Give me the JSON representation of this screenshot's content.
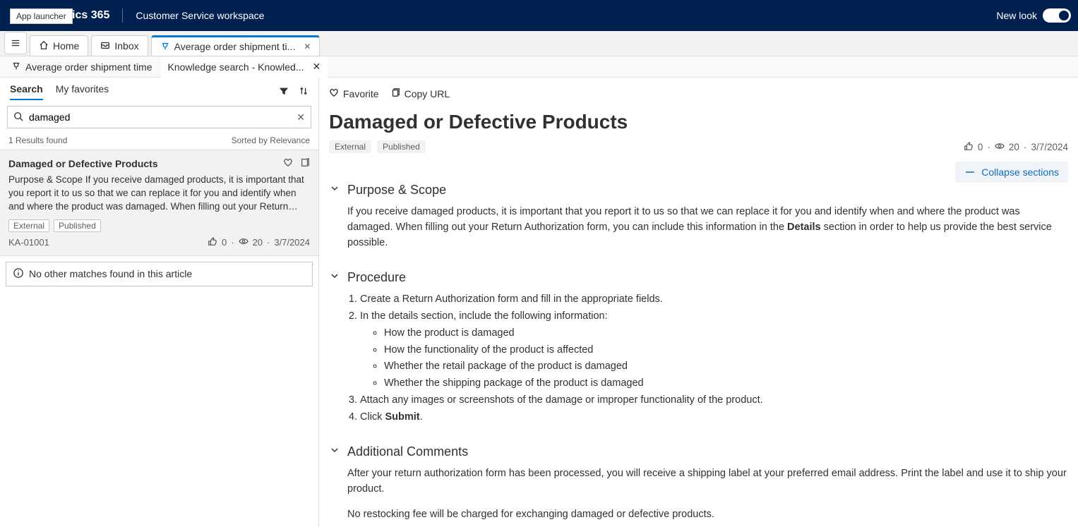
{
  "header": {
    "appLauncherTooltip": "App launcher",
    "brand": "Dynamics 365",
    "brandVisible": "ics 365",
    "workspace": "Customer Service workspace",
    "newLook": "New look"
  },
  "tabs": {
    "home": "Home",
    "inbox": "Inbox",
    "case": "Average order shipment ti..."
  },
  "subtabs": {
    "a": "Average order shipment time",
    "b": "Knowledge search - Knowled..."
  },
  "leftPanel": {
    "searchTab": "Search",
    "favTab": "My favorites",
    "searchValue": "damaged",
    "resultsFound": "1 Results found",
    "sortedBy": "Sorted by Relevance",
    "result": {
      "title": "Damaged or Defective Products",
      "snippet": "Purpose & Scope If you receive damaged products, it is important that you report it to us so that we can replace it for you and identify when and where the product was damaged. When filling out your Return…",
      "chipExternal": "External",
      "chipPublished": "Published",
      "id": "KA-01001",
      "likes": "0",
      "views": "20",
      "date": "3/7/2024"
    },
    "noOther": "No other matches found in this article"
  },
  "article": {
    "favorite": "Favorite",
    "copyUrl": "Copy URL",
    "title": "Damaged or Defective Products",
    "badgeExternal": "External",
    "badgePublished": "Published",
    "likes": "0",
    "views": "20",
    "date": "3/7/2024",
    "collapse": "Collapse sections",
    "sections": {
      "purpose": {
        "heading": "Purpose & Scope",
        "body": "If you receive damaged products, it is important that you report it to us so that we can replace it for you and identify when and where the product was damaged. When filling out your Return Authorization form, you can include this information in the ",
        "detailsWord": "Details",
        "bodyEnd": " section in order to help us provide the best service possible."
      },
      "procedure": {
        "heading": "Procedure",
        "step1": "Create a Return Authorization form and fill in the appropriate fields.",
        "step2": "In the details section, include the following information:",
        "sub1": "How the product is damaged",
        "sub2": "How the functionality of the product is affected",
        "sub3": "Whether the retail package of the product is damaged",
        "sub4": "Whether the shipping package of the product is damaged",
        "step3": "Attach any images or screenshots of the damage or improper functionality of the product.",
        "step4a": "Click ",
        "step4bold": "Submit",
        "step4b": "."
      },
      "additional": {
        "heading": "Additional Comments",
        "p1": "After your return authorization form has been processed, you will receive a shipping label at your preferred email address. Print the label and use it to ship your product.",
        "p2": "No restocking fee will be charged for exchanging damaged or defective products."
      }
    }
  }
}
